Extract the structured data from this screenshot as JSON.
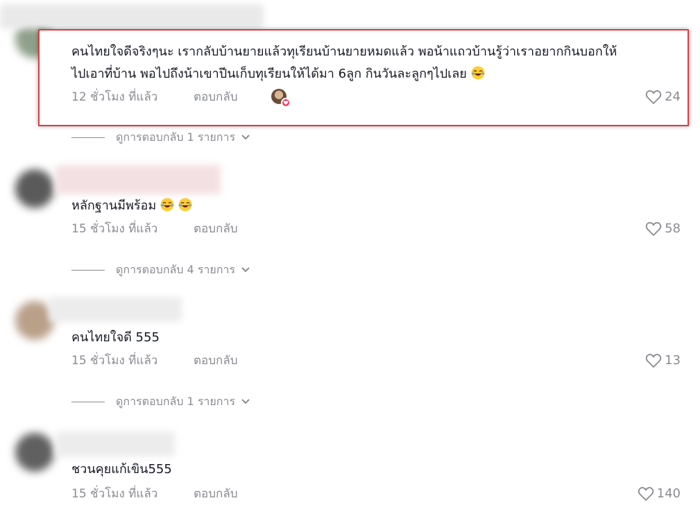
{
  "colors": {
    "highlight": "#e0393e",
    "muted": "#8a8b91",
    "text": "#161823",
    "heart_badge": "#fe2c55"
  },
  "comments": [
    {
      "text_line1": "คนไทยใจดีจริงๆนะ เรากลับบ้านยายแล้วทุเรียนบ้านยายหมดแล้ว พอน้าแถวบ้านรู้ว่าเราอยากกินบอกให้",
      "text_line2": "ไปเอาที่บ้าน พอไปถึงน้าเขาปีนเก็บทุเรียนให้ได้มา 6ลูก กินวันละลูกๆไปเลย",
      "emoji": "laughing-face",
      "time": "12 ชั่วโมง ที่แล้ว",
      "reply": "ตอบกลับ",
      "likes": "24",
      "view_replies": "ดูการตอบกลับ 1 รายการ"
    },
    {
      "text": "หลักฐานมีพร้อม",
      "emoji": "laughing-face x2",
      "time": "15 ชั่วโมง ที่แล้ว",
      "reply": "ตอบกลับ",
      "likes": "58",
      "view_replies": "ดูการตอบกลับ 4 รายการ"
    },
    {
      "text": "คนไทยใจดี 555",
      "time": "15 ชั่วโมง ที่แล้ว",
      "reply": "ตอบกลับ",
      "likes": "13",
      "view_replies": "ดูการตอบกลับ 1 รายการ"
    },
    {
      "text": "ชวนคุยแก้เขิน555",
      "time": "15 ชั่วโมง ที่แล้ว",
      "reply": "ตอบกลับ",
      "likes": "140"
    }
  ]
}
